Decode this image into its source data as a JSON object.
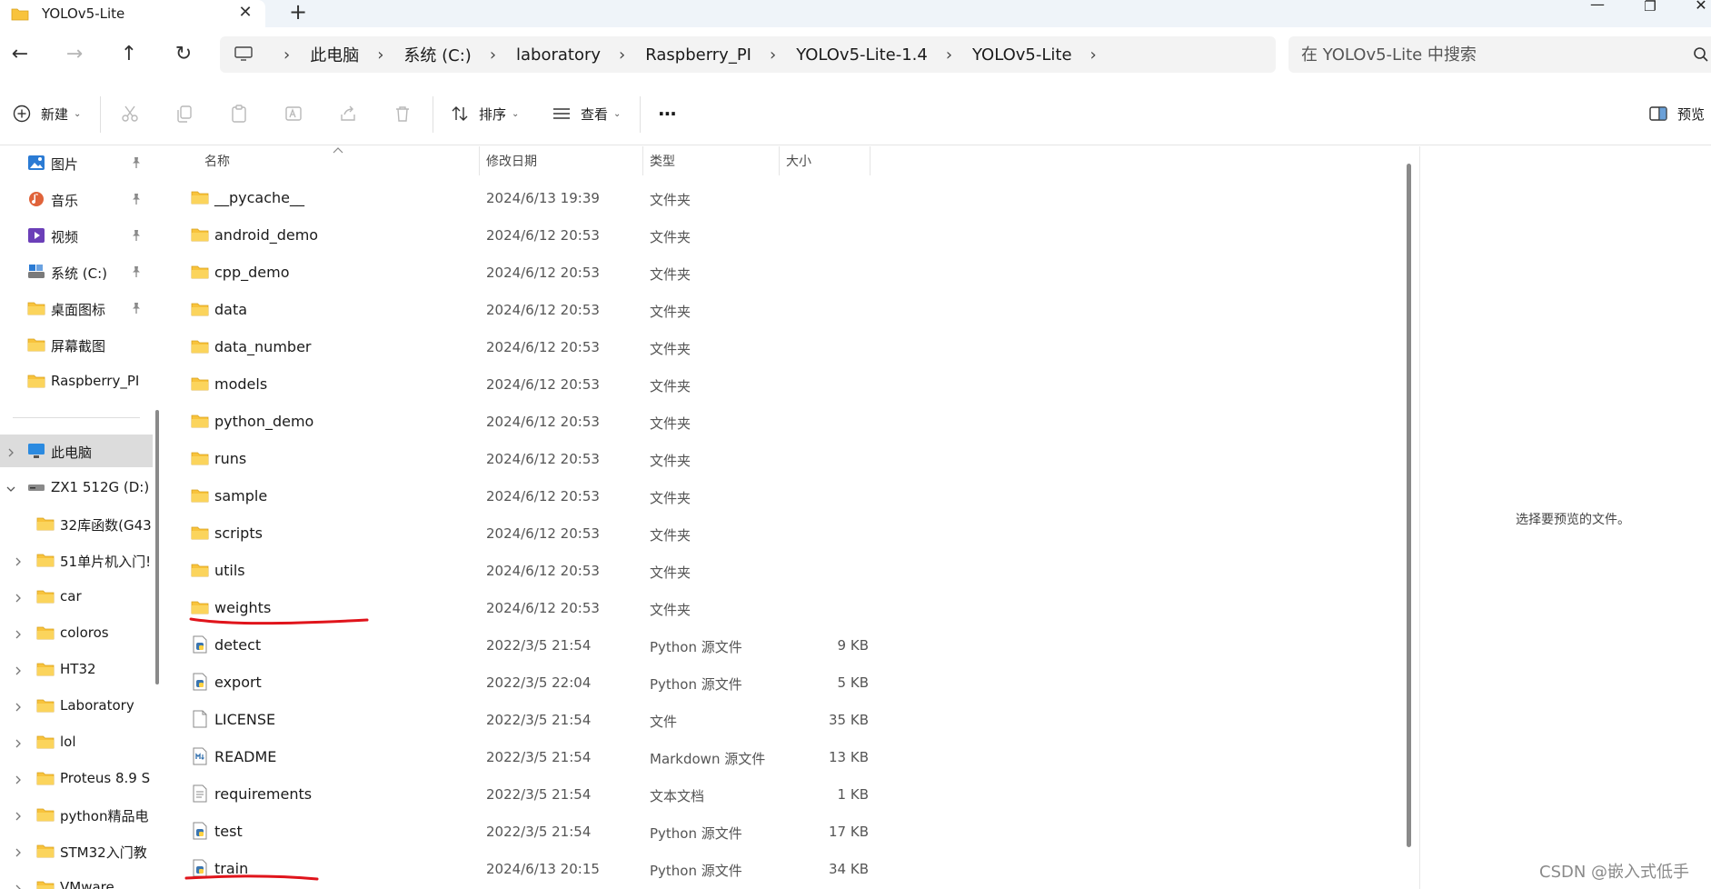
{
  "window": {
    "tab_title": "YOLOv5-Lite",
    "new_tab_glyph": "+",
    "close_glyph": "✕",
    "controls": {
      "minimize": "—",
      "restore": "❐",
      "close": "✕"
    }
  },
  "nav": {
    "back_glyph": "←",
    "forward_glyph": "→",
    "up_glyph": "↑",
    "refresh_glyph": "↻",
    "breadcrumb_sep": "›",
    "breadcrumbs": [
      "此电脑",
      "系统 (C:)",
      "laboratory",
      "Raspberry_PI",
      "YOLOv5-Lite-1.4",
      "YOLOv5-Lite"
    ],
    "search_placeholder": "在 YOLOv5-Lite 中搜索"
  },
  "commands": {
    "new_label": "新建",
    "sort_label": "排序",
    "view_label": "查看",
    "more_glyph": "···",
    "preview_label": "预览",
    "caret": "⌄"
  },
  "sidebar": {
    "quick_access": [
      {
        "label": "图片",
        "icon": "pictures-icon",
        "pinned": true
      },
      {
        "label": "音乐",
        "icon": "music-icon",
        "pinned": true
      },
      {
        "label": "视频",
        "icon": "videos-icon",
        "pinned": true
      },
      {
        "label": "系统 (C:)",
        "icon": "system-drive-icon",
        "pinned": true
      },
      {
        "label": "桌面图标",
        "icon": "folder-icon",
        "pinned": true
      },
      {
        "label": "屏幕截图",
        "icon": "folder-icon",
        "pinned": false
      },
      {
        "label": "Raspberry_PI",
        "icon": "folder-icon",
        "pinned": false
      }
    ],
    "this_pc": "此电脑",
    "drive": "ZX1 512G (D:)",
    "drive_folders": [
      {
        "label": "32库函数(G43",
        "expandable": false
      },
      {
        "label": "51单片机入门!",
        "expandable": true
      },
      {
        "label": "car",
        "expandable": true
      },
      {
        "label": "coloros",
        "expandable": true
      },
      {
        "label": "HT32",
        "expandable": true
      },
      {
        "label": "Laboratory",
        "expandable": true
      },
      {
        "label": "lol",
        "expandable": true
      },
      {
        "label": "Proteus 8.9 S",
        "expandable": true
      },
      {
        "label": "python精品电",
        "expandable": true
      },
      {
        "label": "STM32入门教",
        "expandable": true
      },
      {
        "label": "VMware",
        "expandable": true
      }
    ]
  },
  "columns": {
    "name": "名称",
    "date": "修改日期",
    "type": "类型",
    "size": "大小"
  },
  "files": [
    {
      "name": "__pycache__",
      "date": "2024/6/13 19:39",
      "type": "文件夹",
      "size": "",
      "icon": "folder-icon"
    },
    {
      "name": "android_demo",
      "date": "2024/6/12 20:53",
      "type": "文件夹",
      "size": "",
      "icon": "folder-icon"
    },
    {
      "name": "cpp_demo",
      "date": "2024/6/12 20:53",
      "type": "文件夹",
      "size": "",
      "icon": "folder-icon"
    },
    {
      "name": "data",
      "date": "2024/6/12 20:53",
      "type": "文件夹",
      "size": "",
      "icon": "folder-icon"
    },
    {
      "name": "data_number",
      "date": "2024/6/12 20:53",
      "type": "文件夹",
      "size": "",
      "icon": "folder-icon"
    },
    {
      "name": "models",
      "date": "2024/6/12 20:53",
      "type": "文件夹",
      "size": "",
      "icon": "folder-icon"
    },
    {
      "name": "python_demo",
      "date": "2024/6/12 20:53",
      "type": "文件夹",
      "size": "",
      "icon": "folder-icon"
    },
    {
      "name": "runs",
      "date": "2024/6/12 20:53",
      "type": "文件夹",
      "size": "",
      "icon": "folder-icon"
    },
    {
      "name": "sample",
      "date": "2024/6/12 20:53",
      "type": "文件夹",
      "size": "",
      "icon": "folder-icon"
    },
    {
      "name": "scripts",
      "date": "2024/6/12 20:53",
      "type": "文件夹",
      "size": "",
      "icon": "folder-icon"
    },
    {
      "name": "utils",
      "date": "2024/6/12 20:53",
      "type": "文件夹",
      "size": "",
      "icon": "folder-icon"
    },
    {
      "name": "weights",
      "date": "2024/6/12 20:53",
      "type": "文件夹",
      "size": "",
      "icon": "folder-icon"
    },
    {
      "name": "detect",
      "date": "2022/3/5 21:54",
      "type": "Python 源文件",
      "size": "9 KB",
      "icon": "python-file-icon"
    },
    {
      "name": "export",
      "date": "2022/3/5 22:04",
      "type": "Python 源文件",
      "size": "5 KB",
      "icon": "python-file-icon"
    },
    {
      "name": "LICENSE",
      "date": "2022/3/5 21:54",
      "type": "文件",
      "size": "35 KB",
      "icon": "blank-file-icon"
    },
    {
      "name": "README",
      "date": "2022/3/5 21:54",
      "type": "Markdown 源文件",
      "size": "13 KB",
      "icon": "markdown-file-icon"
    },
    {
      "name": "requirements",
      "date": "2022/3/5 21:54",
      "type": "文本文档",
      "size": "1 KB",
      "icon": "text-file-icon"
    },
    {
      "name": "test",
      "date": "2022/3/5 21:54",
      "type": "Python 源文件",
      "size": "17 KB",
      "icon": "python-file-icon"
    },
    {
      "name": "train",
      "date": "2024/6/13 20:15",
      "type": "Python 源文件",
      "size": "34 KB",
      "icon": "python-file-icon"
    }
  ],
  "preview": {
    "message": "选择要预览的文件。"
  },
  "watermark": "CSDN @嵌入式低手",
  "colors": {
    "folder": "#f8c33c",
    "annotation": "#e0141b",
    "selected": "#dcdcdc",
    "chrome": "#eff4f9"
  }
}
